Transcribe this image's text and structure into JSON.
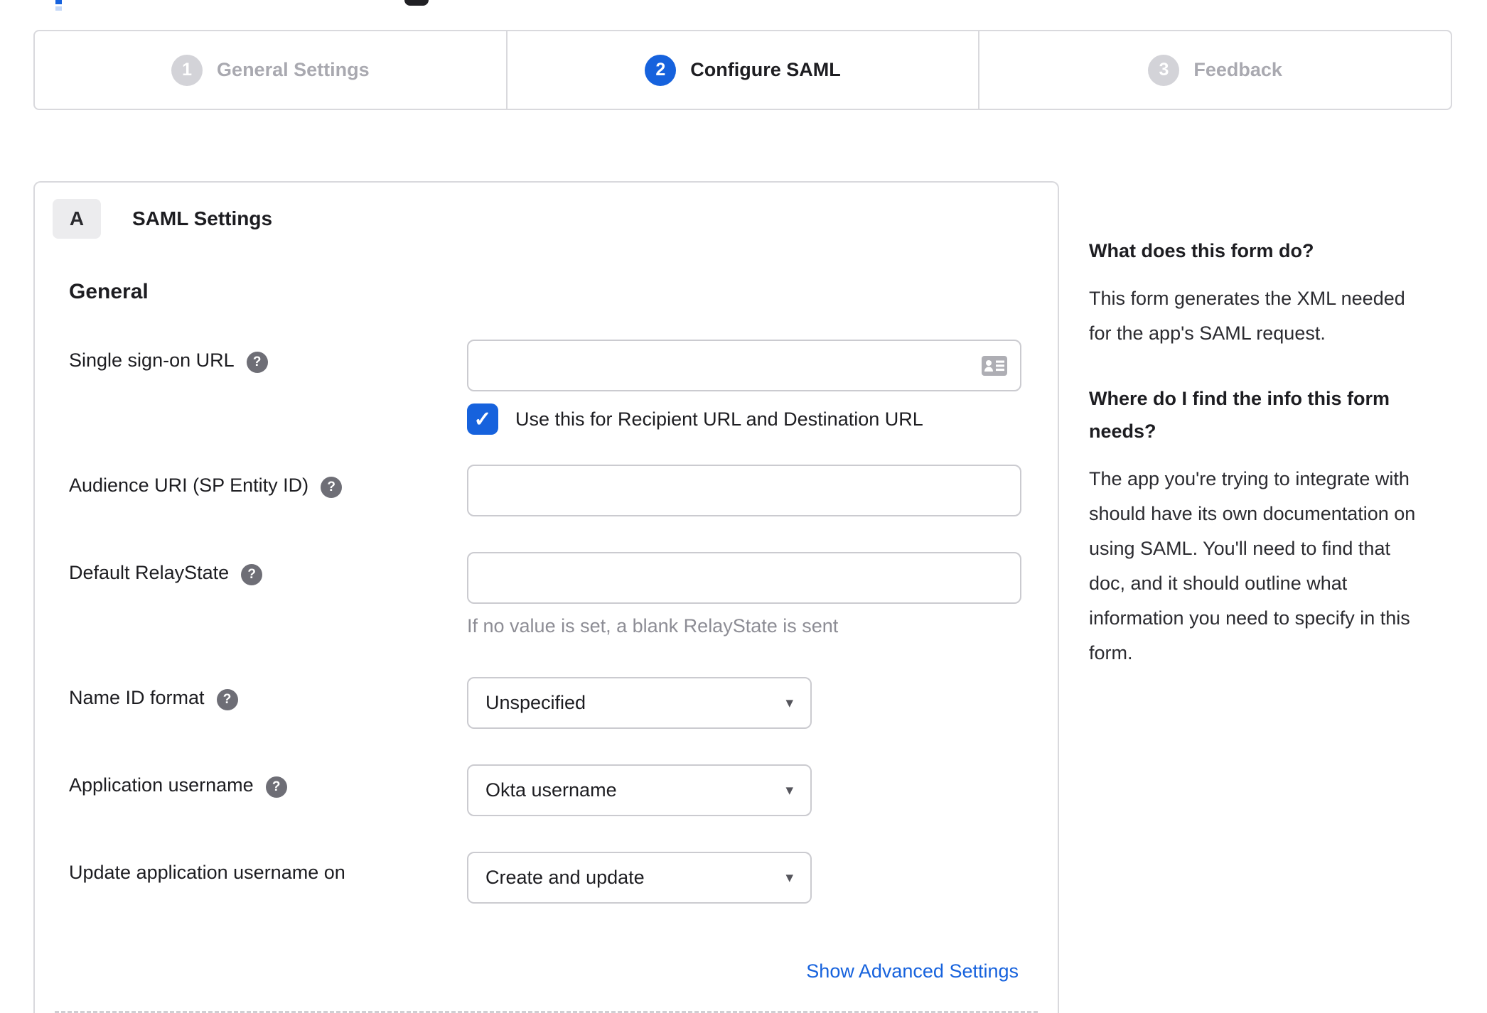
{
  "stepper": {
    "steps": [
      {
        "number": "1",
        "label": "General Settings",
        "state": "inactive"
      },
      {
        "number": "2",
        "label": "Configure SAML",
        "state": "active"
      },
      {
        "number": "3",
        "label": "Feedback",
        "state": "inactive"
      }
    ]
  },
  "panel": {
    "section_badge": "A",
    "section_title": "SAML Settings",
    "group_title": "General",
    "fields": [
      {
        "label": "Single sign-on URL",
        "type": "text",
        "value": "",
        "checkbox": {
          "checked": true,
          "label": "Use this for Recipient URL and Destination URL"
        }
      },
      {
        "label": "Audience URI (SP Entity ID)",
        "type": "text",
        "value": ""
      },
      {
        "label": "Default RelayState",
        "type": "text",
        "value": "",
        "helper": "If no value is set, a blank RelayState is sent"
      },
      {
        "label": "Name ID format",
        "type": "select",
        "value": "Unspecified"
      },
      {
        "label": "Application username",
        "type": "select",
        "value": "Okta username"
      },
      {
        "label": "Update application username on",
        "type": "select",
        "value": "Create and update"
      }
    ],
    "advanced_link": "Show Advanced Settings"
  },
  "help_panel": {
    "sections": [
      {
        "title": "What does this form do?",
        "body": "This form generates the XML needed for the app's SAML request."
      },
      {
        "title": "Where do I find the info this form needs?",
        "body": "The app you're trying to integrate with should have its own documentation on using SAML. You'll need to find that doc, and it should outline what information you need to specify in this form."
      }
    ]
  },
  "icons": {
    "help_glyph": "?",
    "check_glyph": "✓",
    "caret_glyph": "▾"
  },
  "colors": {
    "accent_blue": "#1662dd",
    "inactive_gray": "#a9a9b0",
    "step_circle_gray": "#d3d3d8",
    "panel_border": "#d9d9dd",
    "input_border": "#cbcbd0",
    "helper_text": "#8d8d95",
    "text_dark": "#1d1d21",
    "help_icon_bg": "#6e6e76",
    "badge_bg": "#ececee"
  }
}
